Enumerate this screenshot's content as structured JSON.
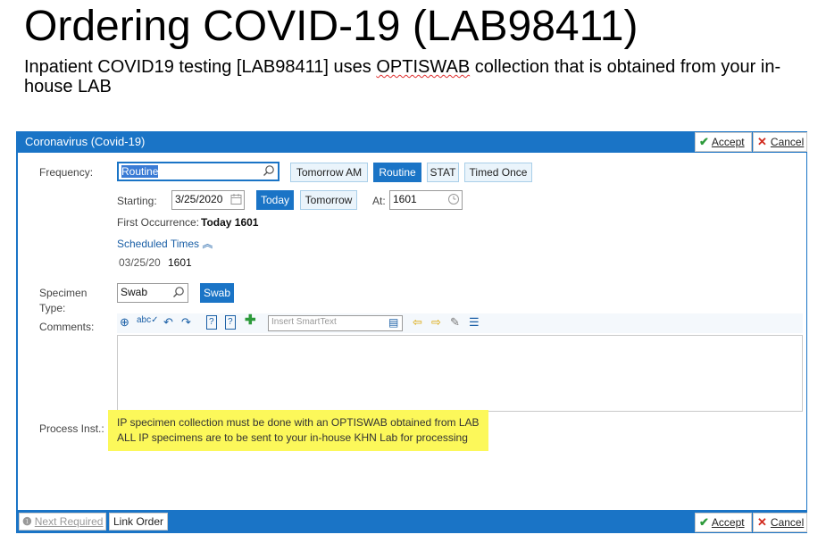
{
  "page": {
    "title": "Ordering COVID-19 (LAB98411)",
    "subtitle_before": "Inpatient COVID19 testing [LAB98411] uses ",
    "subtitle_marked": "OPTISWAB",
    "subtitle_after": " collection that is obtained from your in-house LAB"
  },
  "window": {
    "title": "Coronavirus (Covid-19)",
    "accept_label": "Accept",
    "cancel_label": "Cancel"
  },
  "frequency": {
    "label": "Frequency:",
    "value": "Routine",
    "options": [
      "Tomorrow AM",
      "Routine",
      "STAT",
      "Timed Once"
    ]
  },
  "starting": {
    "label": "Starting:",
    "date": "3/25/2020",
    "today_label": "Today",
    "tomorrow_label": "Tomorrow",
    "at_label": "At:",
    "time": "1601"
  },
  "first_occurrence": {
    "label": "First Occurrence:",
    "value": "Today 1601"
  },
  "scheduled_times": {
    "link_label": "Scheduled Times",
    "date": "03/25/20",
    "time": "1601"
  },
  "specimen": {
    "label_line1": "Specimen",
    "label_line2": "Type:",
    "value": "Swab",
    "option": "Swab"
  },
  "comments": {
    "label": "Comments:",
    "smarttext_placeholder": "Insert SmartText",
    "value": ""
  },
  "process_inst": {
    "label": "Process Inst.:",
    "line1": "IP specimen collection must be done with an OPTISWAB obtained from LAB",
    "line2": "ALL IP specimens are to be sent to your in-house KHN Lab for processing"
  },
  "footer": {
    "next_required_label": "Next Required",
    "link_order_label": "Link Order",
    "accept_label": "Accept",
    "cancel_label": "Cancel"
  },
  "colors": {
    "accent": "#1a74c6",
    "highlight": "#fcf85a",
    "accept_green": "#2c9a3a",
    "cancel_red": "#d12a1e"
  }
}
